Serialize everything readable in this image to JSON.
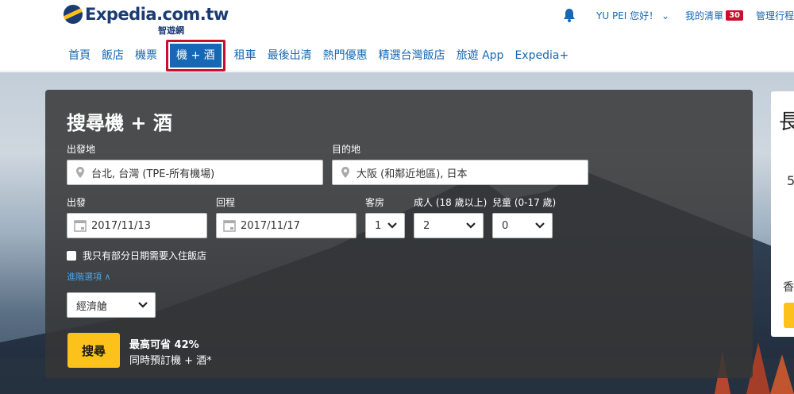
{
  "brand": {
    "logo_text": "Expedia.com.tw",
    "logo_sub": "智遊網"
  },
  "top_right": {
    "user": "YU PEI 您好！",
    "wishlist": "我的清單",
    "wishlist_count": "30",
    "manage": "管理行程"
  },
  "nav": {
    "items": [
      "首頁",
      "飯店",
      "機票",
      "機 + 酒",
      "租車",
      "最後出清",
      "熱門優惠",
      "精選台灣飯店",
      "旅遊 App",
      "Expedia+"
    ],
    "active_index": 3
  },
  "search": {
    "title": "搜尋機 + 酒",
    "origin_label": "出發地",
    "origin_value": "台北, 台灣 (TPE-所有機場)",
    "destination_label": "目的地",
    "destination_value": "大阪 (和鄰近地區), 日本",
    "depart_label": "出發",
    "depart_value": "2017/11/13",
    "return_label": "回程",
    "return_value": "2017/11/17",
    "rooms_label": "客房",
    "rooms_value": "1",
    "adults_label": "成人 (18 歲以上)",
    "adults_value": "2",
    "children_label": "兒童 (0-17 歲)",
    "children_value": "0",
    "partial_stay_label": "我只有部分日期需要入住飯店",
    "advanced_label": "進階選項 ∧",
    "cabin_value": "經濟艙",
    "search_button": "搜尋",
    "save_line1": "最高可省 42%",
    "save_line2": "同時預訂機 + 酒*"
  },
  "side_card": {
    "title": "長",
    "value": "5",
    "text": "香"
  },
  "colors": {
    "brand_blue": "#1668b4",
    "accent_yellow": "#fcc21b",
    "highlight_red": "#c8102e",
    "badge_red": "#c8102e"
  },
  "icons": [
    "logo-globe-icon",
    "bell-icon",
    "chevron-down-icon",
    "location-pin-icon",
    "calendar-icon"
  ]
}
